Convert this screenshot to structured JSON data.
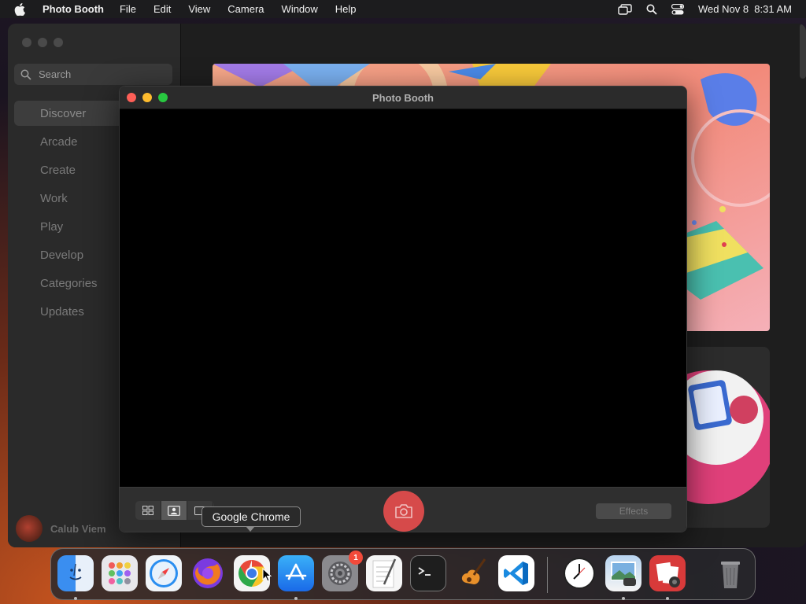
{
  "menubar": {
    "app_name": "Photo Booth",
    "items": [
      "File",
      "Edit",
      "View",
      "Camera",
      "Window",
      "Help"
    ],
    "clock": "Wed Nov 8  8:31 AM"
  },
  "appstore": {
    "search_placeholder": "Search",
    "nav": [
      "Discover",
      "Arcade",
      "Create",
      "Work",
      "Play",
      "Develop",
      "Categories",
      "Updates"
    ],
    "user_name": "Calub Viem"
  },
  "photobooth": {
    "title": "Photo Booth",
    "effects_label": "Effects"
  },
  "tooltip": {
    "text": "Google Chrome"
  },
  "dock": {
    "settings_badge": "1"
  },
  "colors": {
    "close": "#fe5f57",
    "minimize": "#febc2e",
    "maximize": "#28c840",
    "shutter": "#d64a4a"
  }
}
